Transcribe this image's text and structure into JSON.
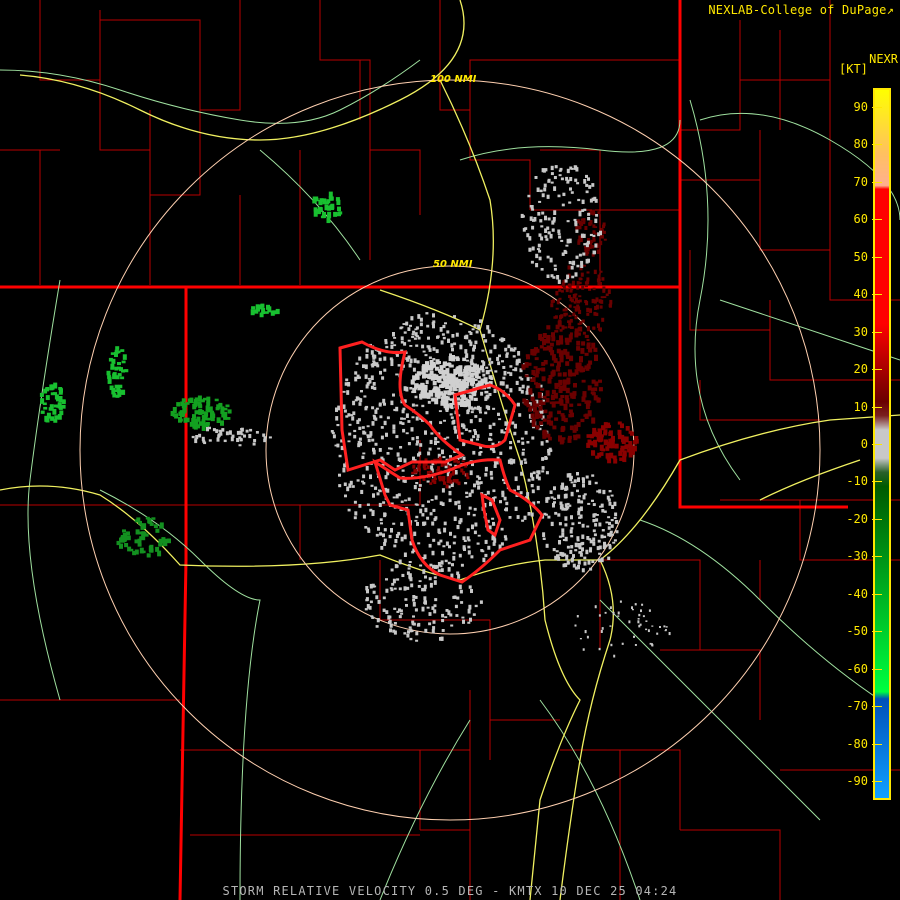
{
  "header": {
    "credit": "NEXLAB-College of DuPage",
    "credit_icon": "external-link-icon"
  },
  "legend": {
    "product": "NEXR",
    "units": "[KT]",
    "ticks": [
      "90",
      "80",
      "70",
      "60",
      "50",
      "40",
      "30",
      "20",
      "10",
      "0",
      "-10",
      "-20",
      "-30",
      "-40",
      "-50",
      "-60",
      "-70",
      "-80",
      "-90"
    ],
    "tick_values": [
      90,
      80,
      70,
      60,
      50,
      40,
      30,
      20,
      10,
      0,
      -10,
      -20,
      -30,
      -40,
      -50,
      -60,
      -70,
      -80,
      -90
    ],
    "range": [
      -95,
      95
    ],
    "colors": {
      "top": "#ffff00",
      "orange": "#ffb060",
      "red": "#ff0000",
      "dark_red": "#6a0000",
      "gray": "#c8c8c8",
      "dark_green": "#005a00",
      "green": "#00ff40",
      "blue": "#0060c8",
      "light_blue": "#10a0ff"
    }
  },
  "rings": {
    "inner": "50 NMI",
    "outer": "100 NMI"
  },
  "colors": {
    "state_border": "#ff0000",
    "county_border": "#b80000",
    "highway": "#f0f060",
    "secondary_road": "#9fe09f",
    "warning_polygon": "#ff2020",
    "ring": "#ffd0b0",
    "footer_text": "#b5b5b5"
  },
  "footer": {
    "caption": "STORM RELATIVE VELOCITY 0.5 DEG - KMTX 10 DEC 25 04:24"
  }
}
